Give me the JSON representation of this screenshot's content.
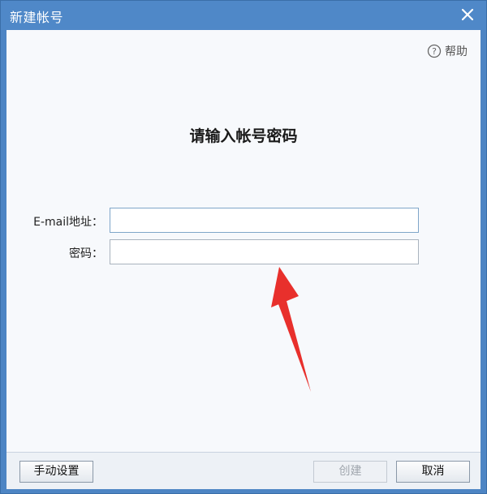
{
  "window": {
    "title": "新建帐号"
  },
  "help": {
    "label": "帮助"
  },
  "heading": "请输入帐号密码",
  "form": {
    "email_label": "E-mail地址：",
    "email_value": "",
    "password_label": "密码：",
    "password_value": ""
  },
  "footer": {
    "manual_label": "手动设置",
    "create_label": "创建",
    "cancel_label": "取消"
  },
  "colors": {
    "titlebar": "#4f88c8",
    "annotation_arrow": "#e8302c"
  },
  "icons": {
    "close": "close-icon",
    "help": "help-icon",
    "arrow": "annotation-arrow"
  }
}
